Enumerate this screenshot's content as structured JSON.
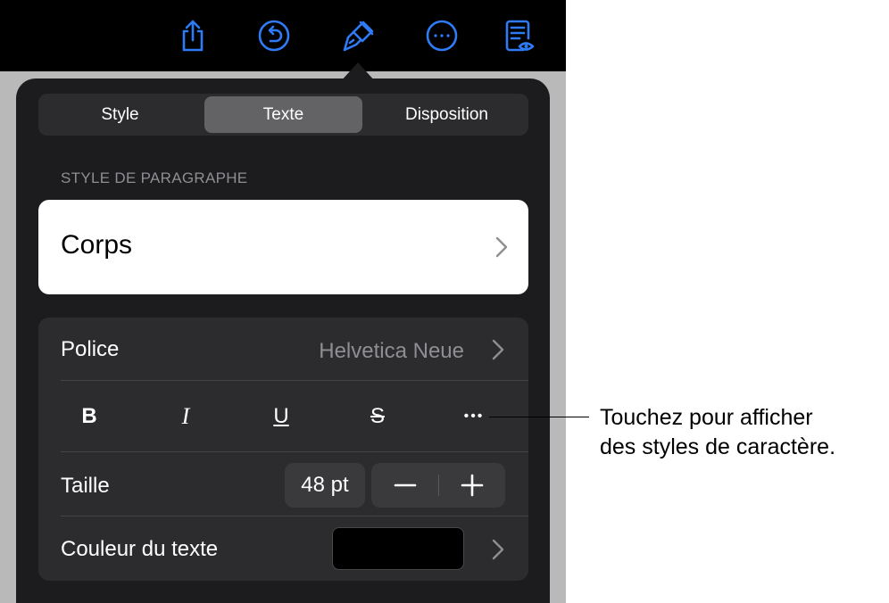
{
  "toolbar": {
    "icons": [
      "share-icon",
      "undo-icon",
      "format-brush-icon",
      "more-icon",
      "reader-view-icon"
    ],
    "icon_color": "#2f7bf6"
  },
  "tabs": [
    {
      "label": "Style",
      "active": false
    },
    {
      "label": "Texte",
      "active": true
    },
    {
      "label": "Disposition",
      "active": false
    }
  ],
  "paragraph_style": {
    "header": "STYLE DE PARAGRAPHE",
    "value": "Corps"
  },
  "font": {
    "label": "Police",
    "value": "Helvetica Neue"
  },
  "char_styles": {
    "bold": "B",
    "italic": "I",
    "underline": "U",
    "strikethrough": "S",
    "more": "•••"
  },
  "size": {
    "label": "Taille",
    "value": "48 pt",
    "decrement": "−",
    "increment": "+"
  },
  "text_color": {
    "label": "Couleur du texte",
    "swatch": "#000000"
  },
  "callout": {
    "line1": "Touchez pour afficher",
    "line2": "des styles de caractère."
  }
}
